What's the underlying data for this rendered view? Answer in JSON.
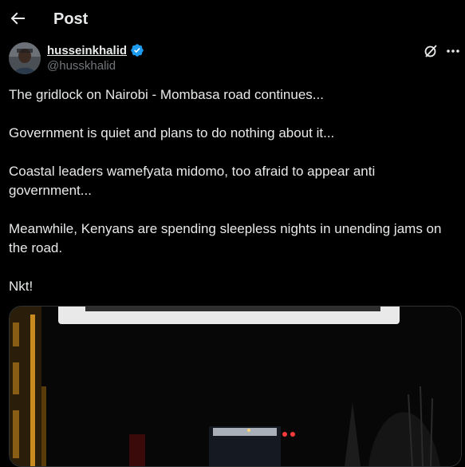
{
  "header": {
    "title": "Post"
  },
  "author": {
    "name": "husseinkhalid",
    "handle": "@husskhalid"
  },
  "tweet": {
    "paragraphs": [
      "The gridlock on Nairobi - Mombasa road continues...",
      "Government is quiet and plans to do nothing about it...",
      "Coastal leaders wamefyata midomo, too afraid to appear anti government...",
      "Meanwhile, Kenyans are spending sleepless nights in unending jams on the road.",
      "Nkt!"
    ]
  },
  "icons": {
    "back": "back-arrow-icon",
    "verified": "verified-badge-icon",
    "grok": "grok-icon",
    "more": "more-options-icon"
  },
  "colors": {
    "background": "#000000",
    "text": "#e7e9ea",
    "muted": "#71767b",
    "verified": "#1d9bf0"
  }
}
